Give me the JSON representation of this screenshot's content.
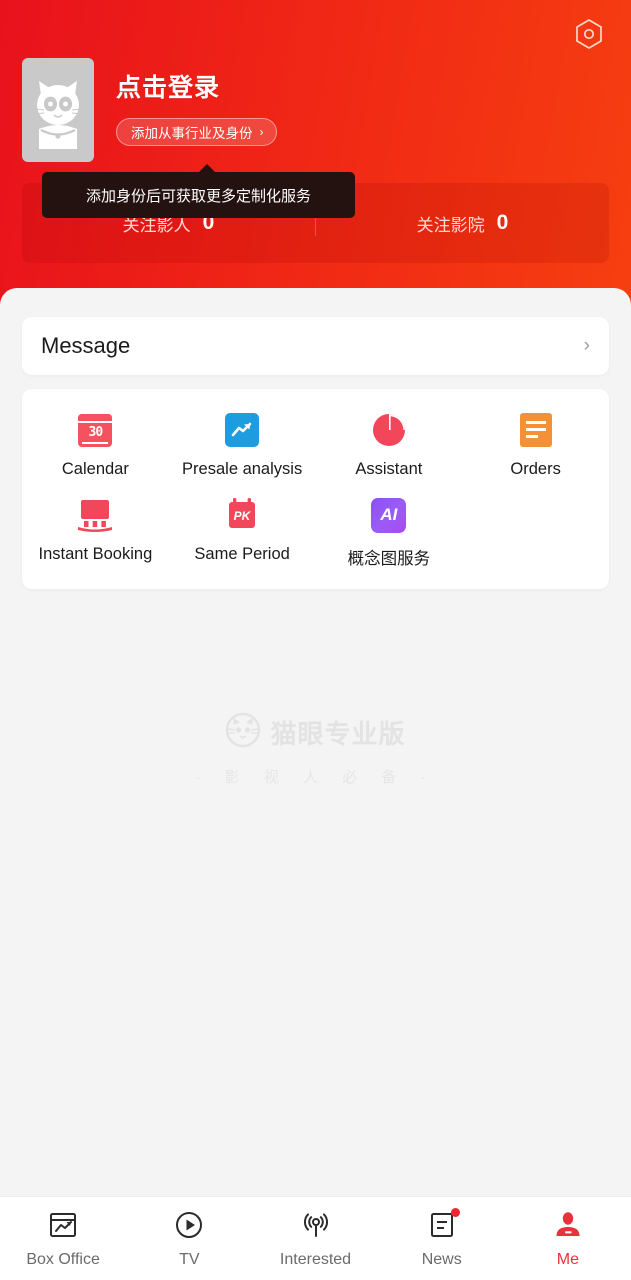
{
  "theme": {
    "hero_red_left": "#e8121c",
    "hero_red_right": "#f63f10",
    "accent_red": "#e8323c",
    "sheet_bg": "#f4f4f4",
    "tooltip_bg": "#231210"
  },
  "hero": {
    "settings_icon": "hexagon-settings-icon",
    "avatar_icon": "cat-avatar-icon",
    "login_title": "点击登录",
    "identity_pill_label": "添加从事行业及身份",
    "identity_pill_chevron": "›",
    "tooltip_text": "添加身份后可获取更多定制化服务",
    "stats": [
      {
        "label": "关注影人",
        "value": "0"
      },
      {
        "label": "关注影院",
        "value": "0"
      }
    ]
  },
  "message_card": {
    "title": "Message",
    "chevron": "›"
  },
  "grid": {
    "rows": [
      [
        {
          "label": "Calendar",
          "icon": "calendar-30-icon",
          "number": "30"
        },
        {
          "label": "Presale analysis",
          "icon": "trend-chart-icon"
        },
        {
          "label": "Assistant",
          "icon": "pie-chart-icon"
        },
        {
          "label": "Orders",
          "icon": "order-document-icon"
        }
      ],
      [
        {
          "label": "Instant Booking",
          "icon": "cinema-screen-icon"
        },
        {
          "label": "Same Period",
          "icon": "calendar-pk-icon",
          "badge_text": "PK"
        },
        {
          "label": "概念图服务",
          "icon": "ai-square-icon",
          "badge_text": "AI"
        }
      ]
    ]
  },
  "watermark": {
    "logo_icon": "maoyan-cat-logo-icon",
    "brand": "猫眼专业版",
    "slogan": "· 影 视 人 必 备 ·"
  },
  "tabbar": {
    "items": [
      {
        "label": "Box Office",
        "icon": "box-office-chart-icon",
        "active": false,
        "badge": false
      },
      {
        "label": "TV",
        "icon": "play-circle-icon",
        "active": false,
        "badge": false
      },
      {
        "label": "Interested",
        "icon": "radar-signal-icon",
        "active": false,
        "badge": false
      },
      {
        "label": "News",
        "icon": "news-document-icon",
        "active": false,
        "badge": true
      },
      {
        "label": "Me",
        "icon": "person-icon",
        "active": true,
        "badge": false
      }
    ]
  }
}
